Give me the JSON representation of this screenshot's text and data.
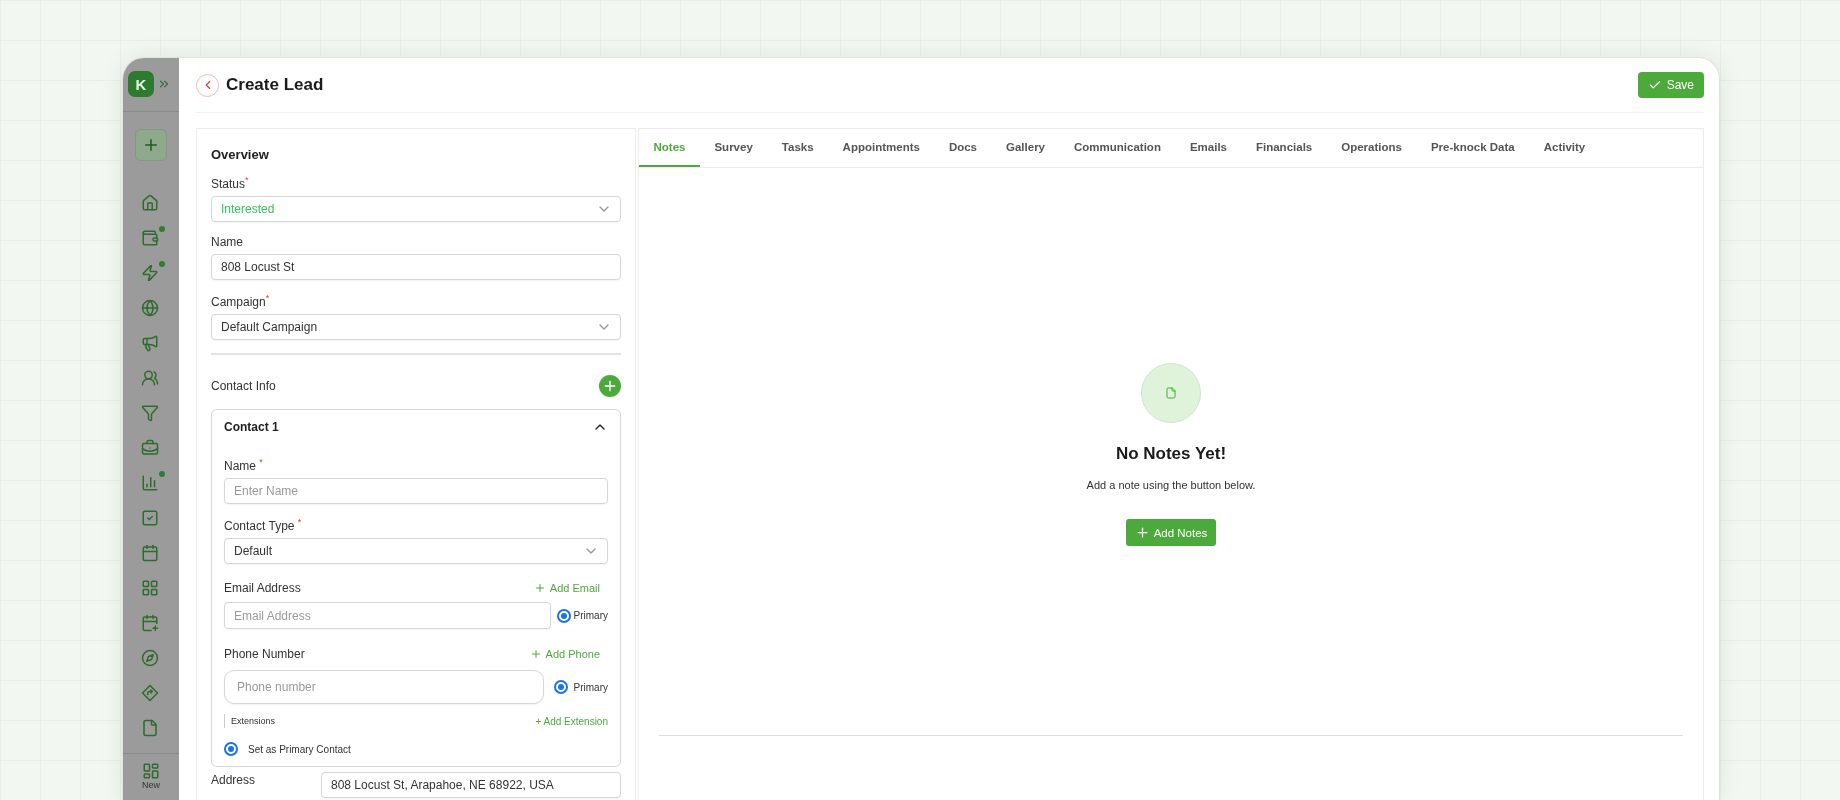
{
  "sidebar": {
    "logo": "K",
    "items": [
      {
        "dot": false
      },
      {
        "dot": true
      },
      {
        "dot": true
      },
      {
        "dot": false
      },
      {
        "dot": false
      },
      {
        "dot": false
      },
      {
        "dot": false
      },
      {
        "dot": false
      },
      {
        "dot": true
      },
      {
        "dot": false
      },
      {
        "dot": false
      },
      {
        "dot": false
      },
      {
        "dot": false
      },
      {
        "dot": false
      },
      {
        "dot": false
      },
      {
        "dot": false
      }
    ],
    "bottom_item": {
      "label": "New"
    }
  },
  "header": {
    "title": "Create Lead",
    "save_button": "Save"
  },
  "overview": {
    "heading": "Overview",
    "fields": [
      {
        "kind": "select",
        "label": "Status$^{*}$",
        "value": "Interested",
        "color": "#34c759"
      },
      {
        "kind": "text",
        "label": "Name",
        "value": "808 Locust St"
      },
      {
        "kind": "select",
        "label": "Campaign$^{*}$",
        "value": "Default Campaign"
      }
    ]
  },
  "contact_info": {
    "label": "Contact Info",
    "contact": {
      "title": "Contact 1",
      "expanded": true,
      "name": {
        "label": "Name $^{*}$",
        "placeholder": "Enter Name"
      },
      "contact_type": {
        "label": "Contact Type $^{*}$",
        "value": "Default"
      },
      "email": {
        "label": "Email Address",
        "add": "Add Email",
        "placeholder": "Email Address",
        "primary_label": "Primary",
        "primary": true
      },
      "phone": {
        "label": "Phone Number",
        "add": "Add Phone",
        "placeholder": "Phone number",
        "primary_label": "Primary",
        "primary": true
      },
      "extensions": {
        "label": "Extensions",
        "add": "+ Add Extension"
      },
      "primary_contact": {
        "label": "Set as Primary Contact",
        "selected": true
      }
    }
  },
  "address": {
    "label": "Address",
    "value": "808 Locust St, Arapahoe, NE 68922, USA"
  },
  "tabs": [
    {
      "label": "Notes",
      "selected": true
    },
    {
      "label": "Survey",
      "selected": false
    },
    {
      "label": "Tasks",
      "selected": false
    },
    {
      "label": "Appointments",
      "selected": false
    },
    {
      "label": "Docs",
      "selected": false
    },
    {
      "label": "Gallery",
      "selected": false
    },
    {
      "label": "Communication",
      "selected": false
    },
    {
      "label": "Emails",
      "selected": false
    },
    {
      "label": "Financials",
      "selected": false
    },
    {
      "label": "Operations",
      "selected": false
    },
    {
      "label": "Pre-knock Data",
      "selected": false
    },
    {
      "label": "Activity",
      "selected": false
    }
  ],
  "empty_state": {
    "title": "No Notes Yet!",
    "text": "Add a note using the button below.",
    "button": "Add Notes"
  }
}
